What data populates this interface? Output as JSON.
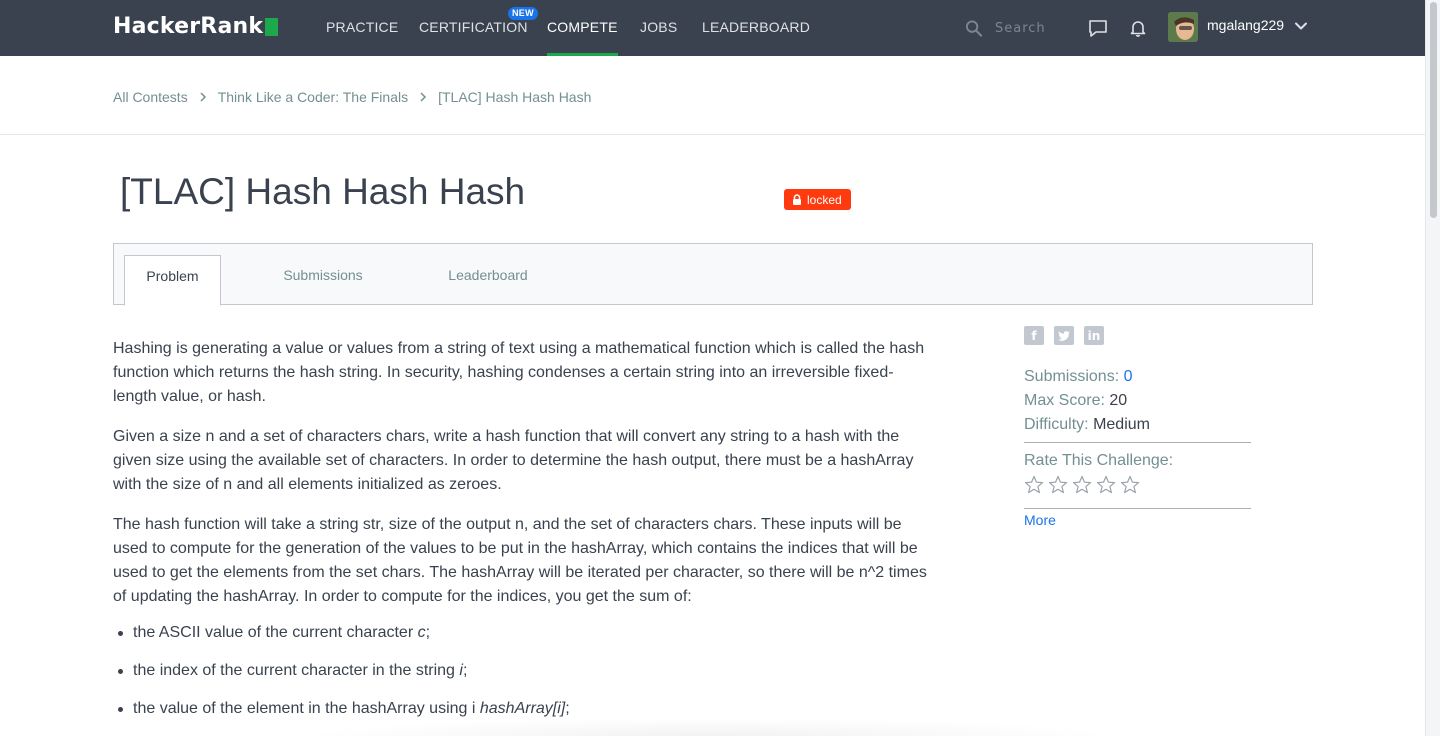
{
  "nav": {
    "logo_text": "HackerRank",
    "items": [
      {
        "label": "PRACTICE"
      },
      {
        "label": "CERTIFICATION",
        "badge": "NEW"
      },
      {
        "label": "COMPETE"
      },
      {
        "label": "JOBS"
      },
      {
        "label": "LEADERBOARD"
      }
    ],
    "search_placeholder": "Search",
    "username": "mgalang229"
  },
  "breadcrumb": [
    "All Contests",
    "Think Like a Coder: The Finals",
    "[TLAC] Hash Hash Hash"
  ],
  "challenge": {
    "title": "[TLAC] Hash Hash Hash",
    "status_badge": "locked"
  },
  "tabs": [
    {
      "label": "Problem"
    },
    {
      "label": "Submissions"
    },
    {
      "label": "Leaderboard"
    }
  ],
  "problem": {
    "paragraphs": [
      "Hashing is generating a value or values from a string of text using a mathematical function which is called the hash function which returns the hash string. In security, hashing condenses a certain string into an irreversible fixed-length value, or hash.",
      "Given a size n and a set of characters chars, write a hash function that will convert any string to a hash with the given size using the available set of characters. In order to determine the hash output, there must be a hashArray with the size of n and all elements initialized as zeroes.",
      "The hash function will take a string str, size of the output n, and the set of characters chars. These inputs will be used to compute for the generation of the values to be put in the hashArray, which contains the indices that will be used to get the elements from the set chars. The hashArray will be iterated per character, so there will be n^2 times of updating the hashArray. In order to compute for the indices, you get the sum of:"
    ],
    "bullets": [
      {
        "text": "the ASCII value of the current character ",
        "var": "c",
        "end": ";"
      },
      {
        "text": "the index of the current character in the string ",
        "var": "i",
        "end": ";"
      },
      {
        "text": "the value of the element in the hashArray using i ",
        "var": "hashArray[i]",
        "end": ";"
      }
    ]
  },
  "sidebar": {
    "share": [
      "facebook-icon",
      "twitter-icon",
      "linkedin-icon"
    ],
    "submissions_label": "Submissions:",
    "submissions_value": "0",
    "max_score_label": "Max Score:",
    "max_score_value": "20",
    "difficulty_label": "Difficulty:",
    "difficulty_value": "Medium",
    "rate_label": "Rate This Challenge:",
    "rating": 0,
    "rating_max": 5,
    "more_label": "More"
  },
  "colors": {
    "nav_bg": "#39424e",
    "accent_green": "#1ba94c",
    "new_badge": "#1a73e8",
    "locked_badge": "#ff3a0f",
    "link_blue": "#1a73e8"
  }
}
